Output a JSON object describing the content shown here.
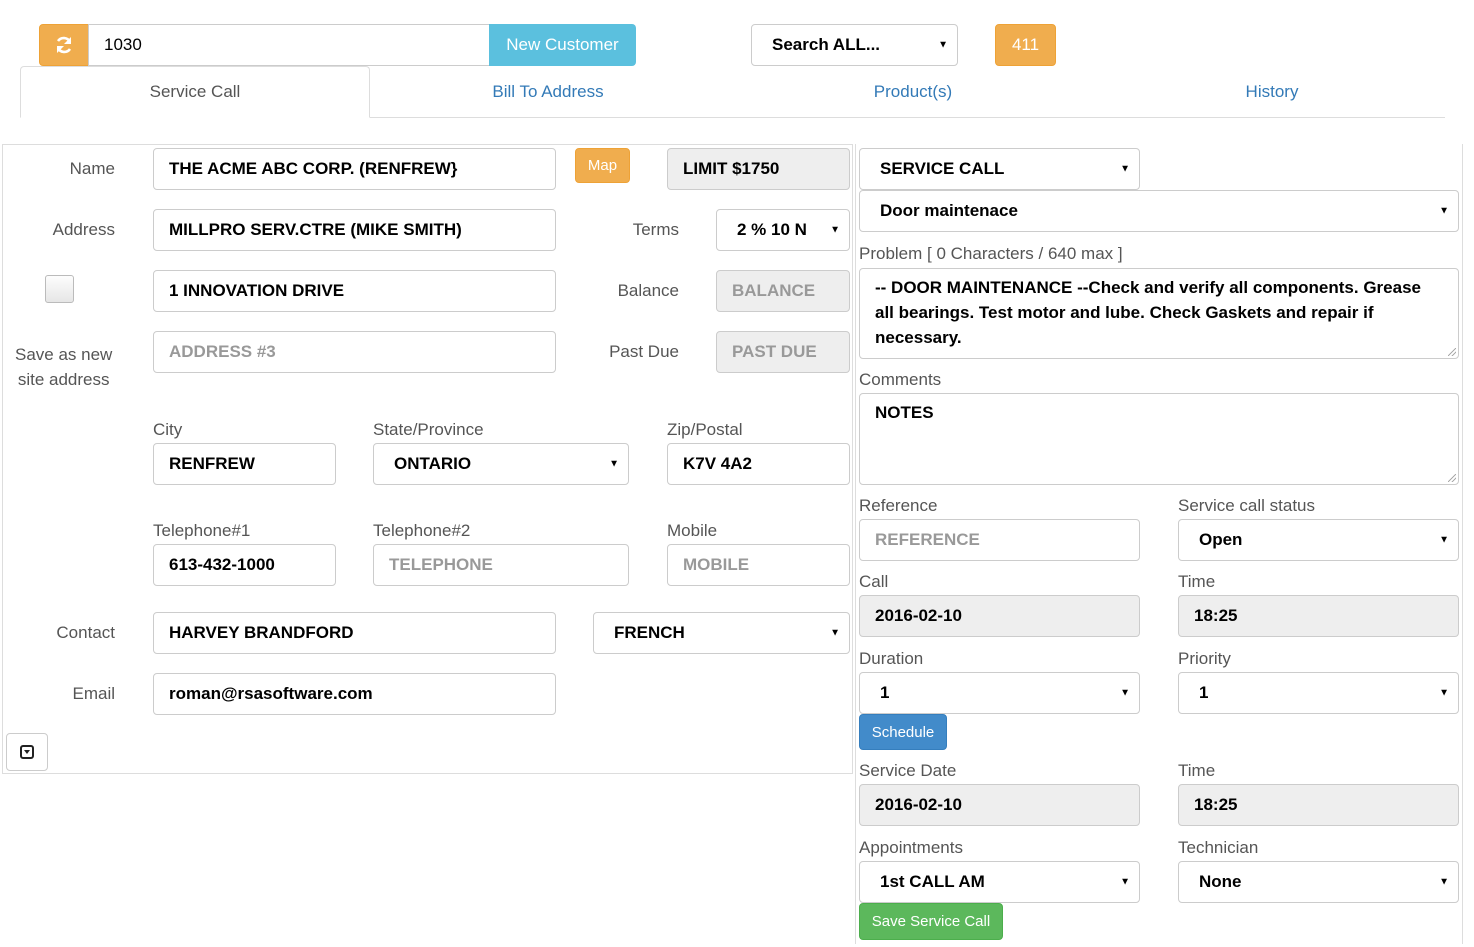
{
  "topbar": {
    "refresh_icon": "refresh-icon",
    "customer_number": "1030",
    "new_customer_label": "New Customer",
    "search_select": "Search ALL...",
    "count_badge": "411"
  },
  "tabs": [
    {
      "label": "Service Call",
      "active": true
    },
    {
      "label": "Bill To Address",
      "active": false
    },
    {
      "label": "Product(s)",
      "active": false
    },
    {
      "label": "History",
      "active": false
    }
  ],
  "customer": {
    "name_label": "Name",
    "name_value": "THE ACME ABC CORP. (RENFREW}",
    "map_label": "Map",
    "limit_value": "LIMIT $1750",
    "address_label": "Address",
    "address1_value": "MILLPRO SERV.CTRE (MIKE SMITH)",
    "terms_label": "Terms",
    "terms_value": "2 % 10 N",
    "address2_value": "1 INNOVATION DRIVE",
    "balance_label": "Balance",
    "balance_placeholder": "BALANCE",
    "address3_placeholder": "ADDRESS #3",
    "past_due_label": "Past Due",
    "past_due_placeholder": "PAST DUE",
    "save_site_label_line1": "Save as new",
    "save_site_label_line2": "site address",
    "city_label": "City",
    "city_value": "RENFREW",
    "state_label": "State/Province",
    "state_value": "ONTARIO",
    "zip_label": "Zip/Postal",
    "zip_value": "K7V 4A2",
    "tel1_label": "Telephone#1",
    "tel1_value": "613-432-1000",
    "tel2_label": "Telephone#2",
    "tel2_placeholder": "TELEPHONE",
    "mobile_label": "Mobile",
    "mobile_placeholder": "MOBILE",
    "contact_label": "Contact",
    "contact_value": "HARVEY BRANDFORD",
    "language_value": "FRENCH",
    "email_label": "Email",
    "email_value": "roman@rsasoftware.com"
  },
  "service": {
    "call_type_value": "SERVICE CALL",
    "problem_type_value": "Door maintenace",
    "problem_label": "Problem [ 0 Characters / 640 max ]",
    "problem_text": "-- DOOR MAINTENANCE --Check and verify all components. Grease all bearings. Test motor and lube. Check Gaskets and repair if necessary.",
    "comments_label": "Comments",
    "comments_text": "NOTES",
    "reference_label": "Reference",
    "reference_placeholder": "REFERENCE",
    "status_label": "Service call status",
    "status_value": "Open",
    "call_label": "Call",
    "call_date": "2016-02-10",
    "call_time_label": "Time",
    "call_time": "18:25",
    "duration_label": "Duration",
    "duration_value": "1",
    "priority_label": "Priority",
    "priority_value": "1",
    "schedule_label": "Schedule",
    "service_date_label": "Service Date",
    "service_date": "2016-02-10",
    "service_time_label": "Time",
    "service_time": "18:25",
    "appointments_label": "Appointments",
    "appointments_value": "1st CALL AM",
    "technician_label": "Technician",
    "technician_value": "None",
    "save_label": "Save Service Call"
  },
  "colors": {
    "orange": "#f0ad4e",
    "info": "#5bc0de",
    "primary": "#428bca",
    "success": "#5cb85c",
    "link": "#337ab7"
  }
}
